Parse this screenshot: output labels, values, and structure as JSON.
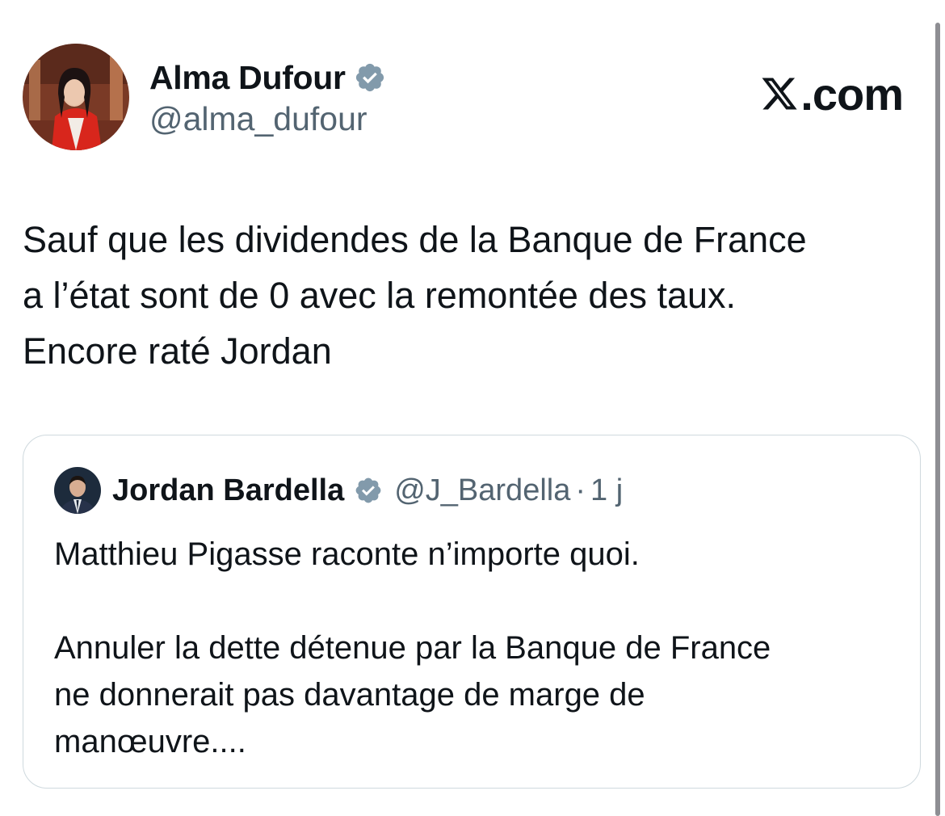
{
  "tweet": {
    "author": {
      "name": "Alma Dufour",
      "handle": "@alma_dufour"
    },
    "source_logo": {
      "domain": ".com"
    },
    "text": "Sauf que les dividendes de la Banque de France\na l’état sont de 0 avec la remontée des taux.\nEncore raté Jordan",
    "quoted": {
      "author_name": "Jordan Bardella",
      "handle": "@J_Bardella",
      "separator": "·",
      "time": "1 j",
      "text": "Matthieu Pigasse raconte n’importe quoi.\n\nAnnuler la dette détenue par la Banque de France\nne donnerait pas davantage de marge de\nmanœuvre...."
    }
  },
  "icons": {
    "verified": "verified-badge-icon",
    "x_logo": "x-logo-icon"
  },
  "colors": {
    "text": "#0f1419",
    "secondary": "#536471",
    "verified_badge": "#829aab",
    "border": "#cfd9de"
  }
}
